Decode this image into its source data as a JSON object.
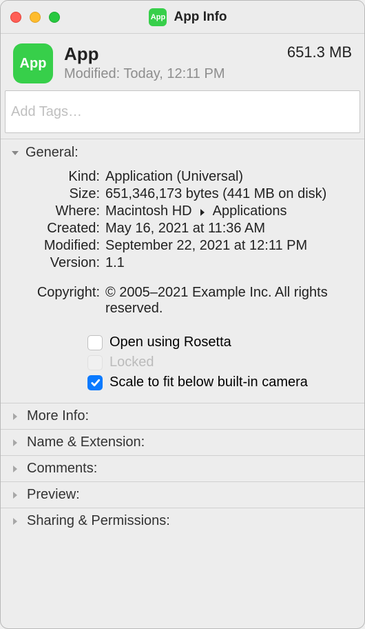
{
  "window": {
    "title": "App Info"
  },
  "header": {
    "app_name": "App",
    "modified_label": "Modified:",
    "modified_value": "Today, 12:11 PM",
    "size": "651.3 MB",
    "icon_label": "App"
  },
  "tags": {
    "placeholder": "Add Tags…"
  },
  "general": {
    "title": "General:",
    "kind_label": "Kind:",
    "kind_value": "Application (Universal)",
    "size_label": "Size:",
    "size_value": "651,346,173 bytes (441 MB on disk)",
    "where_label": "Where:",
    "where_value_1": "Macintosh HD",
    "where_value_2": "Applications",
    "created_label": "Created:",
    "created_value": "May 16, 2021 at 11:36 AM",
    "modified_label": "Modified:",
    "modified_value": "September 22, 2021 at 12:11 PM",
    "version_label": "Version:",
    "version_value": "1.1",
    "copyright_label": "Copyright:",
    "copyright_value": "© 2005–2021 Example Inc. All rights reserved.",
    "rosetta_label": "Open using Rosetta",
    "locked_label": "Locked",
    "scale_label": "Scale to fit below built-in camera"
  },
  "sections": {
    "more_info": "More Info:",
    "name_ext": "Name & Extension:",
    "comments": "Comments:",
    "preview": "Preview:",
    "sharing": "Sharing & Permissions:"
  }
}
